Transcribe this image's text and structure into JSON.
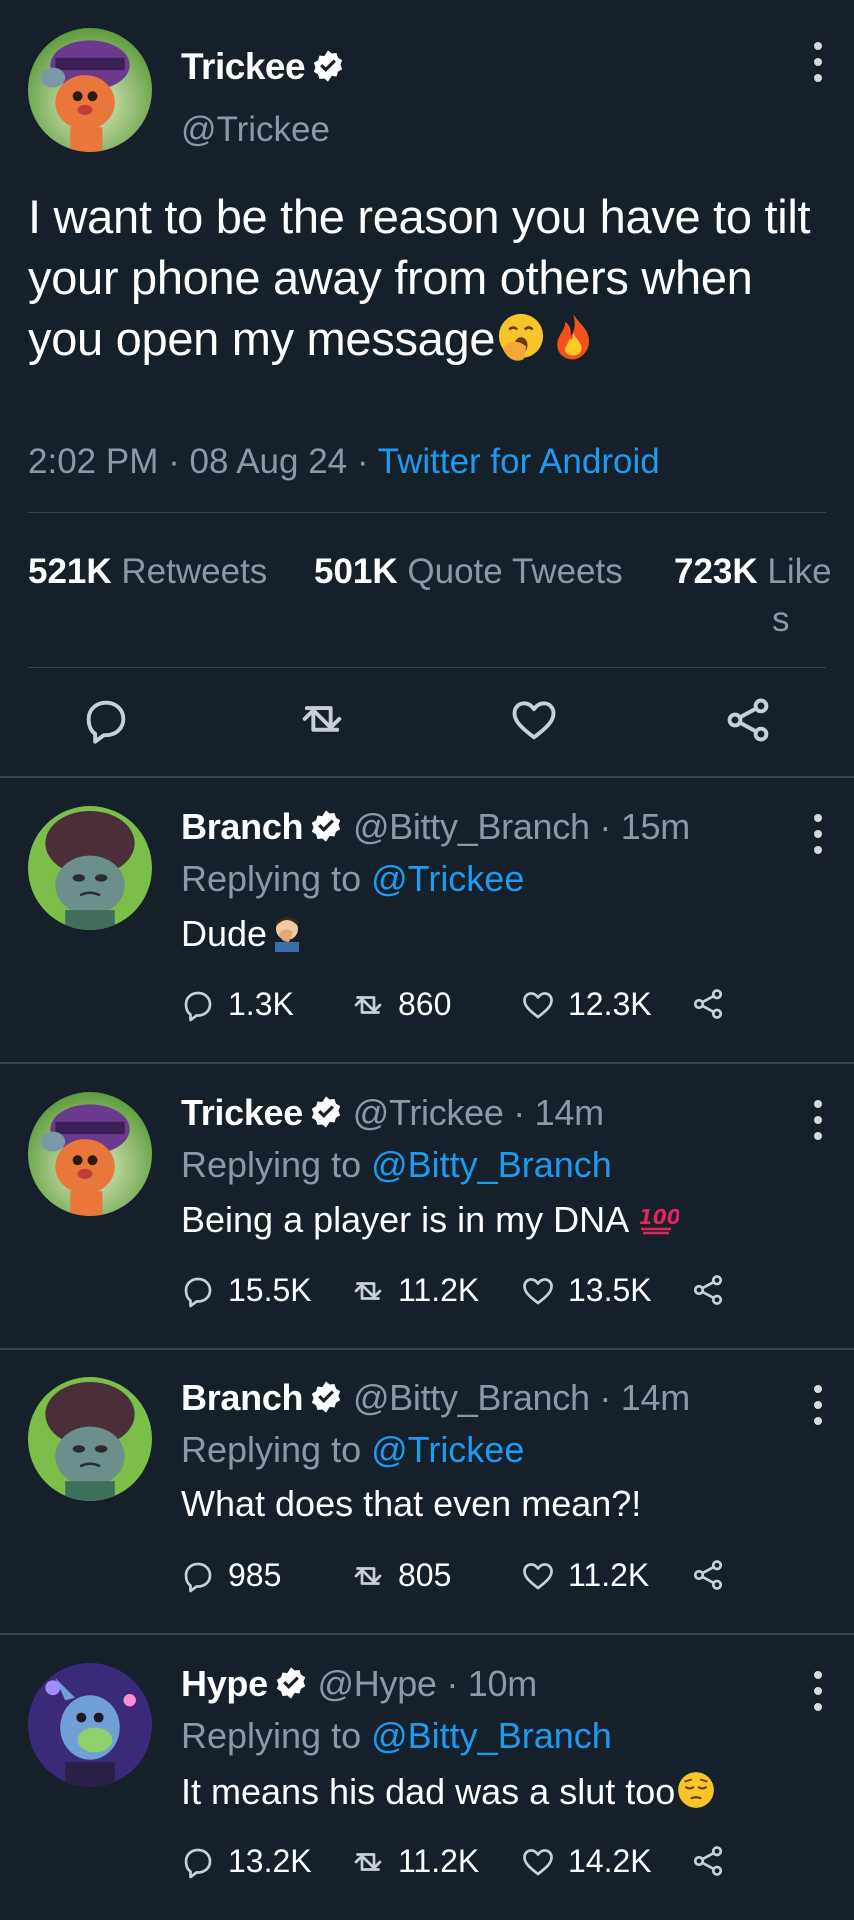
{
  "main": {
    "name": "Trickee",
    "handle": "@Trickee",
    "text": "I want to be the reason you have to tilt your phone away from others when you open my message",
    "time": "2:02 PM",
    "date": "08 Aug 24",
    "client": "Twitter for Android",
    "stats": {
      "retweets_count": "521K",
      "retweets_label": "Retweets",
      "quotes_count": "501K",
      "quotes_label": "Quote Tweets",
      "likes_count": "723K",
      "likes_label_a": "Like",
      "likes_label_b": "s"
    },
    "icons": [
      "reply-icon",
      "retweet-icon",
      "like-icon",
      "share-icon"
    ]
  },
  "replies": [
    {
      "name": "Branch",
      "handle": "@Bitty_Branch",
      "time": "15m",
      "replying_label": "Replying to",
      "replying_to": "@Trickee",
      "text": "Dude",
      "replies": "1.3K",
      "retweets": "860",
      "likes": "12.3K"
    },
    {
      "name": "Trickee",
      "handle": "@Trickee",
      "time": "14m",
      "replying_label": "Replying to",
      "replying_to": "@Bitty_Branch",
      "text": "Being a player is in my DNA",
      "replies": "15.5K",
      "retweets": "11.2K",
      "likes": "13.5K"
    },
    {
      "name": "Branch",
      "handle": "@Bitty_Branch",
      "time": "14m",
      "replying_label": "Replying to",
      "replying_to": "@Trickee",
      "text": "What does that even mean?!",
      "replies": "985",
      "retweets": "805",
      "likes": "11.2K"
    },
    {
      "name": "Hype",
      "handle": "@Hype",
      "time": "10m",
      "replying_label": "Replying to",
      "replying_to": "@Bitty_Branch",
      "text": "It means his dad was a slut too",
      "replies": "13.2K",
      "retweets": "11.2K",
      "likes": "14.2K"
    }
  ],
  "separator": "·",
  "colors": {
    "background": "#15202b",
    "accent": "#1d9bf0",
    "muted": "#8b98a5",
    "divider": "#38444d"
  }
}
